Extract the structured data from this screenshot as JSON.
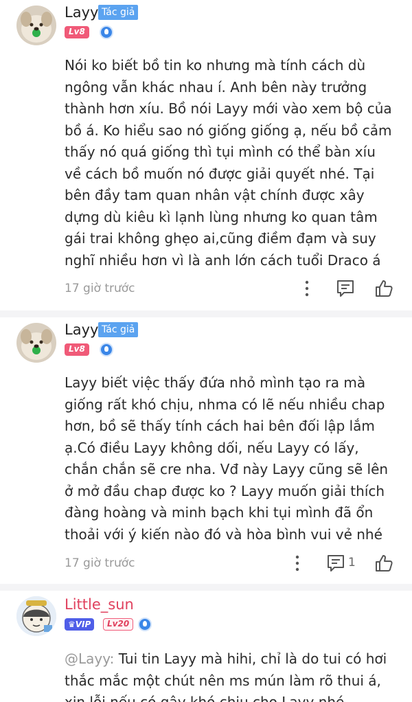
{
  "comments": [
    {
      "username": "Layy",
      "author_badge": "Tác giả",
      "level": "Lv8",
      "rank_icon": "water-drop-icon",
      "text": "Nói ko biết bồ tin ko nhưng mà tính cách dù ngông vẫn khác nhau í. Anh bên này trưởng thành hơn xíu. Bồ nói Layy mới vào xem bộ của bồ á. Ko hiểu sao nó giống giống ạ, nếu bồ cảm thấy nó quá giống thì tụi mình có thể bàn xíu về cách bồ muốn nó được giải quyết nhé. Tại bên đầy tam quan nhân vật chính được xây dựng dù kiêu kì lạnh lùng nhưng ko quan tâm gái trai không ghẹo ai,cũng điềm đạm và suy nghĩ nhiều hơn vì là anh lớn cách tuổi Draco á",
      "time": "17 giờ trước",
      "reply_count": ""
    },
    {
      "username": "Layy",
      "author_badge": "Tác giả",
      "level": "Lv8",
      "rank_icon": "water-drop-icon",
      "text": "Layy biết việc thấy đứa nhỏ mình tạo ra mà giống rất khó chịu, nhma có lẽ nếu nhiều chap hơn, bồ sẽ thấy tính cách hai bên đối lập lắm ạ.Có điều Layy không dối, nếu Layy có lấy, chắn chắn sẽ cre nha. Vđ này Layy cũng sẽ lên ở mở đầu chap được ko ? Layy muốn giải thích đàng hoàng và minh bạch khi tụi mình đã ổn thoải với ý kiến nào đó và hòa bình vui vẻ nhé",
      "time": "17 giờ trước",
      "reply_count": "1"
    },
    {
      "username": "Little_sun",
      "vip_badge": "VIP",
      "level": "Lv20",
      "rank_icon": "water-drop-icon",
      "mention": "@Layy:",
      "text": " Tui tin Layy mà hihi, chỉ là do tui có hơi thắc mắc một chút nên ms mún làm rõ thui á, xin lỗi nếu có gây khó chịu cho Layy nhé"
    }
  ],
  "colors": {
    "author_badge": "#5ba3f0",
    "level_badge": "#f05a78",
    "vip_badge": "#4f5ee8",
    "username_pink": "#e0415e"
  }
}
